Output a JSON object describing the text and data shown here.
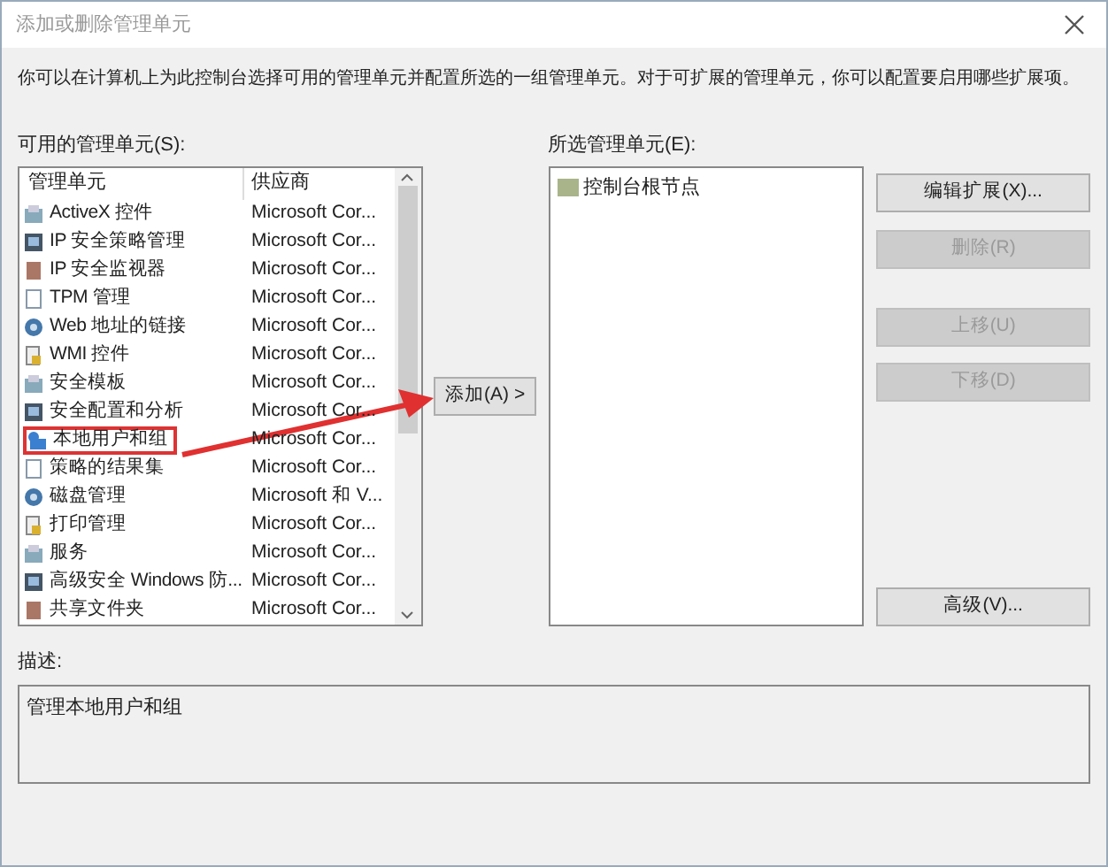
{
  "window": {
    "title": "添加或删除管理单元"
  },
  "intro": "你可以在计算机上为此控制台选择可用的管理单元并配置所选的一组管理单元。对于可扩展的管理单元，你可以配置要启用哪些扩展项。",
  "available": {
    "label": "可用的管理单元(S):",
    "columns": [
      "管理单元",
      "供应商"
    ],
    "rows": [
      {
        "name": "ActiveX 控件",
        "vendor": "Microsoft Cor...",
        "highlighted": false
      },
      {
        "name": "IP 安全策略管理",
        "vendor": "Microsoft Cor...",
        "highlighted": false
      },
      {
        "name": "IP 安全监视器",
        "vendor": "Microsoft Cor...",
        "highlighted": false
      },
      {
        "name": "TPM 管理",
        "vendor": "Microsoft Cor...",
        "highlighted": false
      },
      {
        "name": "Web 地址的链接",
        "vendor": "Microsoft Cor...",
        "highlighted": false
      },
      {
        "name": "WMI 控件",
        "vendor": "Microsoft Cor...",
        "highlighted": false
      },
      {
        "name": "安全模板",
        "vendor": "Microsoft Cor...",
        "highlighted": false
      },
      {
        "name": "安全配置和分析",
        "vendor": "Microsoft Cor...",
        "highlighted": false
      },
      {
        "name": "本地用户和组",
        "vendor": "Microsoft Cor...",
        "highlighted": true
      },
      {
        "name": "策略的结果集",
        "vendor": "Microsoft Cor...",
        "highlighted": false
      },
      {
        "name": "磁盘管理",
        "vendor": "Microsoft 和 V...",
        "highlighted": false
      },
      {
        "name": "打印管理",
        "vendor": "Microsoft Cor...",
        "highlighted": false
      },
      {
        "name": "服务",
        "vendor": "Microsoft Cor...",
        "highlighted": false
      },
      {
        "name": "高级安全 Windows 防...",
        "vendor": "Microsoft Cor...",
        "highlighted": false
      },
      {
        "name": "共享文件夹",
        "vendor": "Microsoft Cor...",
        "highlighted": false
      }
    ]
  },
  "add_button": {
    "label": "添加(A) >"
  },
  "selected": {
    "label": "所选管理单元(E):",
    "items": [
      "控制台根节点"
    ]
  },
  "buttons": [
    {
      "label": "编辑扩展(X)...",
      "disabled": false
    },
    {
      "label": "删除(R)",
      "disabled": true
    },
    {
      "label": "上移(U)",
      "disabled": true
    },
    {
      "label": "下移(D)",
      "disabled": true
    },
    {
      "label": "高级(V)...",
      "disabled": false
    }
  ],
  "description": {
    "label": "描述:",
    "text": "管理本地用户和组"
  }
}
